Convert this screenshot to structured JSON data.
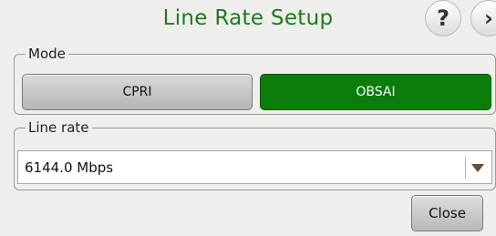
{
  "dialog": {
    "title": "Line Rate Setup",
    "help_icon": "question-mark-icon",
    "next_icon": "chevron-right-icon"
  },
  "mode": {
    "legend": "Mode",
    "options": [
      {
        "label": "CPRI",
        "selected": false
      },
      {
        "label": "OBSAI",
        "selected": true
      }
    ],
    "selected_color": "#0a7d0a"
  },
  "line_rate": {
    "legend": "Line rate",
    "selected_value": "6144.0 Mbps"
  },
  "footer": {
    "close_label": "Close"
  }
}
